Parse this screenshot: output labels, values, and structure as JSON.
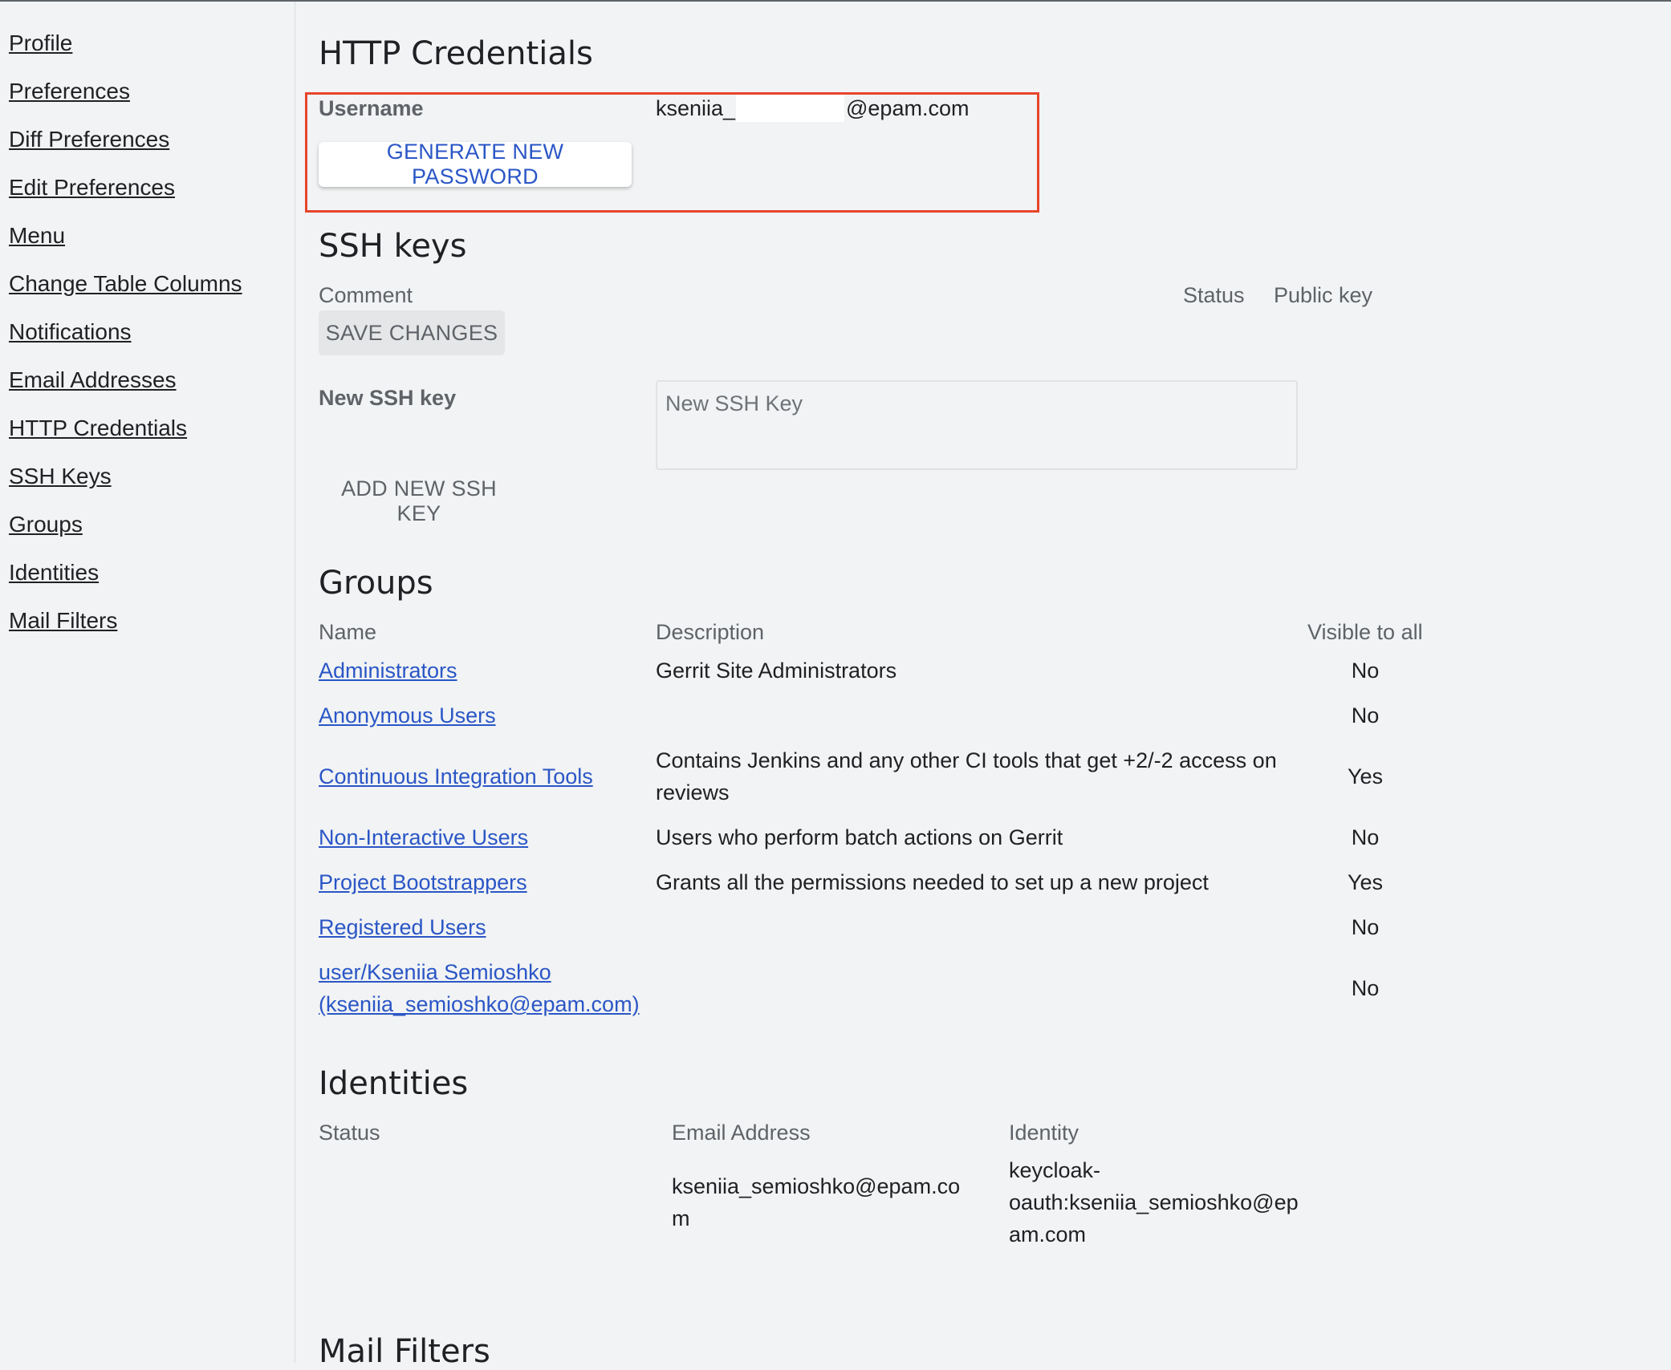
{
  "sidebar": {
    "items": [
      {
        "label": "Profile"
      },
      {
        "label": "Preferences"
      },
      {
        "label": "Diff Preferences"
      },
      {
        "label": "Edit Preferences"
      },
      {
        "label": "Menu"
      },
      {
        "label": "Change Table Columns"
      },
      {
        "label": "Notifications"
      },
      {
        "label": "Email Addresses"
      },
      {
        "label": "HTTP Credentials"
      },
      {
        "label": "SSH Keys"
      },
      {
        "label": "Groups"
      },
      {
        "label": "Identities"
      },
      {
        "label": "Mail Filters"
      }
    ]
  },
  "http_credentials": {
    "title": "HTTP Credentials",
    "username_label": "Username",
    "username_prefix": "kseniia_",
    "username_suffix": "@epam.com",
    "generate_button": "GENERATE NEW PASSWORD",
    "highlight_color": "#e8442c"
  },
  "ssh_keys": {
    "title": "SSH keys",
    "columns": {
      "comment": "Comment",
      "status": "Status",
      "public_key": "Public key"
    },
    "save_button": "SAVE CHANGES",
    "new_key_label": "New SSH key",
    "new_key_placeholder": "New SSH Key",
    "add_button": "ADD NEW SSH KEY"
  },
  "groups": {
    "title": "Groups",
    "columns": {
      "name": "Name",
      "description": "Description",
      "visible": "Visible to all"
    },
    "rows": [
      {
        "name": "Administrators",
        "description": "Gerrit Site Administrators",
        "visible": "No"
      },
      {
        "name": "Anonymous Users",
        "description": "",
        "visible": "No"
      },
      {
        "name": "Continuous Integration Tools",
        "description_line1": "Contains Jenkins and any other CI tools that get +2/-2 access on",
        "description_line2": "reviews",
        "visible": "Yes"
      },
      {
        "name": "Non-Interactive Users",
        "description": "Users who perform batch actions on Gerrit",
        "visible": "No"
      },
      {
        "name": "Project Bootstrappers",
        "description": "Grants all the permissions needed to set up a new project",
        "visible": "Yes"
      },
      {
        "name": "Registered Users",
        "description": "",
        "visible": "No"
      },
      {
        "name_line1": "user/Kseniia Semioshko",
        "name_line2": "(kseniia_semioshko@epam.com)",
        "description": "",
        "visible": "No"
      }
    ],
    "link_color": "#2a56c6"
  },
  "identities": {
    "title": "Identities",
    "columns": {
      "status": "Status",
      "email": "Email Address",
      "identity": "Identity"
    },
    "row": {
      "email_line1": "kseniia_semioshko@epam.co",
      "email_line2": "m",
      "identity_line1": "keycloak-",
      "identity_line2": "oauth:kseniia_semioshko@ep",
      "identity_line3": "am.com"
    }
  },
  "mail_filters": {
    "title": "Mail Filters"
  }
}
